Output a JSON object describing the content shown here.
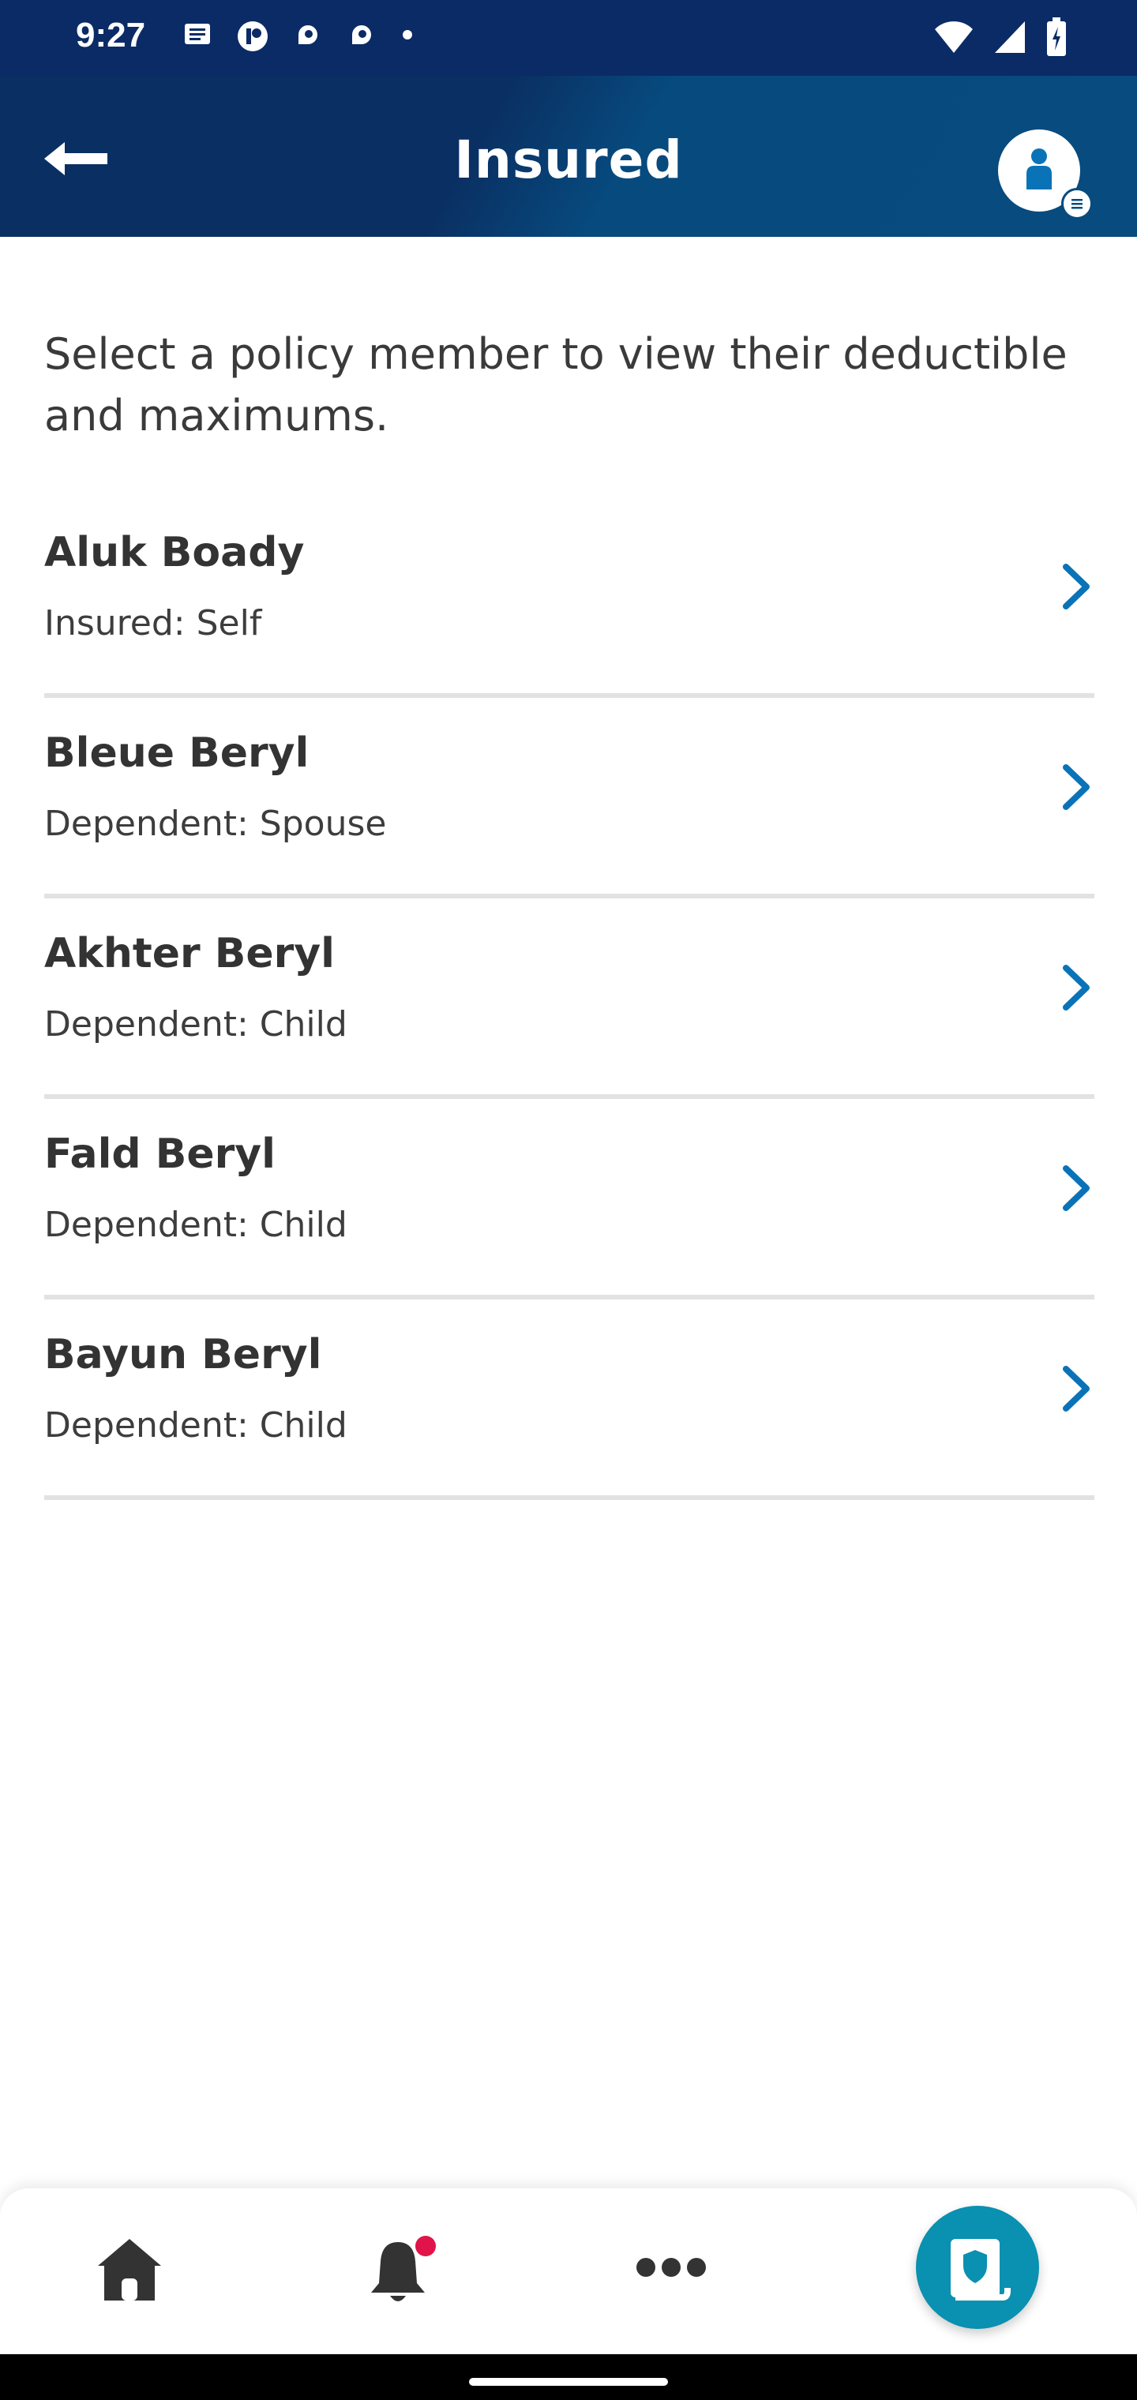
{
  "status_bar": {
    "time": "9:27",
    "icons_left": [
      "message-icon",
      "app-icon",
      "app-icon",
      "app-icon",
      "dot-icon"
    ],
    "icons_right": [
      "wifi-icon",
      "cell-signal-icon",
      "battery-icon"
    ]
  },
  "header": {
    "title": "Insured",
    "back_icon": "arrow-left-icon",
    "profile_icon": "user-menu-icon"
  },
  "intro_text": "Select a policy member to view their deductible and maximums.",
  "members": [
    {
      "name": "Aluk Boady",
      "role": "Insured: Self"
    },
    {
      "name": "Bleue Beryl",
      "role": "Dependent: Spouse"
    },
    {
      "name": "Akhter Beryl",
      "role": "Dependent: Child"
    },
    {
      "name": "Fald Beryl",
      "role": "Dependent: Child"
    },
    {
      "name": "Bayun Beryl",
      "role": "Dependent: Child"
    }
  ],
  "bottom_nav": {
    "items": [
      "home-icon",
      "bell-icon",
      "more-icon",
      "id-card-icon"
    ]
  },
  "colors": {
    "header": "#0a3063",
    "accent_blue": "#0a73b8",
    "fab": "#0a90b0",
    "notification": "#e0144a"
  }
}
